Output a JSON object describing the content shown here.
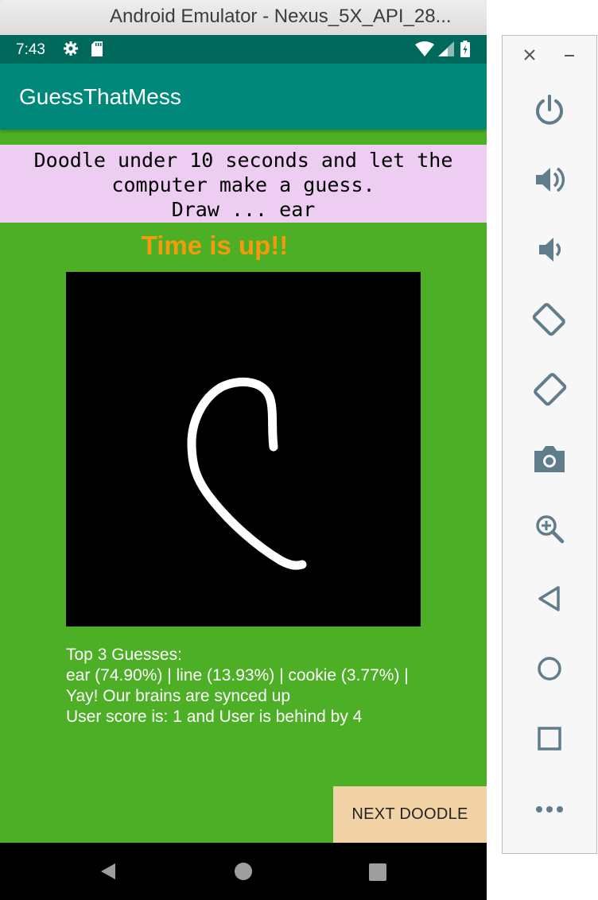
{
  "window": {
    "title": "Android Emulator - Nexus_5X_API_28..."
  },
  "status_bar": {
    "time": "7:43",
    "icons": [
      "gear-icon",
      "sd-card-icon",
      "wifi-icon",
      "signal-icon",
      "battery-icon"
    ]
  },
  "app": {
    "title": "GuessThatMess",
    "instructions": {
      "line1": "Doodle under 10 seconds and let the",
      "line2": "computer make a guess.",
      "line3": "Draw ... ear"
    },
    "status_message": "Time is up!!",
    "results": {
      "heading": "Top 3 Guesses:",
      "guesses": "ear (74.90%) | line (13.93%) | cookie (3.77%) |",
      "verdict": "Yay! Our brains are synced up",
      "score": "User score is: 1 and  User is behind by 4"
    },
    "next_button": "NEXT DOODLE"
  },
  "nav_bar": {
    "icons": [
      "back-icon",
      "home-icon",
      "recents-icon"
    ]
  },
  "emulator_toolbar": {
    "window_controls": [
      "close-icon",
      "minimize-icon"
    ],
    "buttons": [
      "power-icon",
      "volume-up-icon",
      "volume-down-icon",
      "rotate-left-icon",
      "rotate-right-icon",
      "camera-icon",
      "zoom-icon",
      "back-icon",
      "home-icon",
      "overview-icon",
      "more-icon"
    ]
  },
  "colors": {
    "status_bar": "#00695c",
    "app_bar": "#00897b",
    "background": "#4caf25",
    "instructions_bg": "#edcdf2",
    "time_up": "#f59a0c",
    "button_bg": "#f2d3a6",
    "toolbar_icon": "#607d8b"
  }
}
